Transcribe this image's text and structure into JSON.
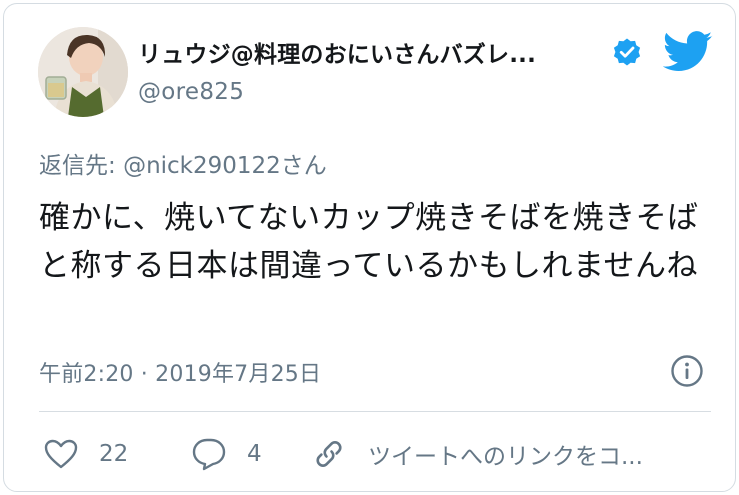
{
  "tweet": {
    "author": {
      "display_name": "リュウジ@料理のおにいさんバズレ...",
      "handle": "@ore825"
    },
    "reply_to": {
      "prefix": "返信先: ",
      "mention": "@nick290122",
      "suffix": "さん"
    },
    "text": "確かに、焼いてないカップ焼きそばを焼きそばと称する日本は間違っているかもしれませんね",
    "timestamp": "午前2:20 · 2019年7月25日",
    "likes": "22",
    "replies": "4",
    "copy_link_label": "ツイートへのリンクをコ..."
  },
  "icons": {
    "verified": "verified-badge-icon",
    "brand": "twitter-bird-icon",
    "info": "info-icon",
    "like": "heart-icon",
    "reply": "comment-bubble-icon",
    "link": "link-icon"
  },
  "colors": {
    "brand": "#1da1f2",
    "secondary_text": "#657786",
    "primary_text": "#14171a",
    "divider": "#d7dde2"
  }
}
